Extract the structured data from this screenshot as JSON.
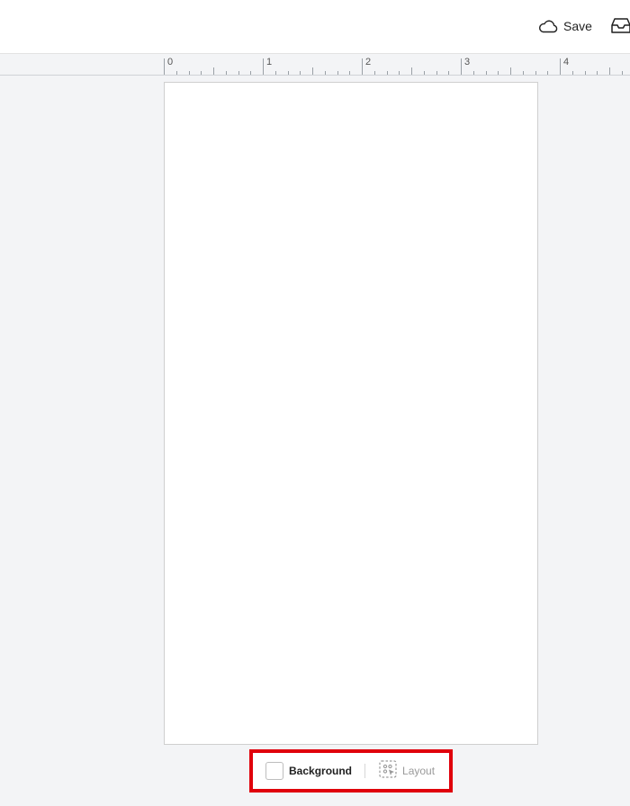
{
  "topbar": {
    "save_label": "Save",
    "save_icon": "cloud-icon",
    "inbox_icon": "inbox-icon"
  },
  "ruler": {
    "labels": [
      "0",
      "1",
      "2",
      "3",
      "4"
    ]
  },
  "bottom_toolbar": {
    "background_label": "Background",
    "background_swatch_color": "#ffffff",
    "layout_label": "Layout",
    "layout_icon": "layout-select-icon",
    "layout_disabled": true
  },
  "colors": {
    "workspace_bg": "#f3f4f6",
    "page_bg": "#ffffff",
    "highlight": "#e0000b"
  }
}
